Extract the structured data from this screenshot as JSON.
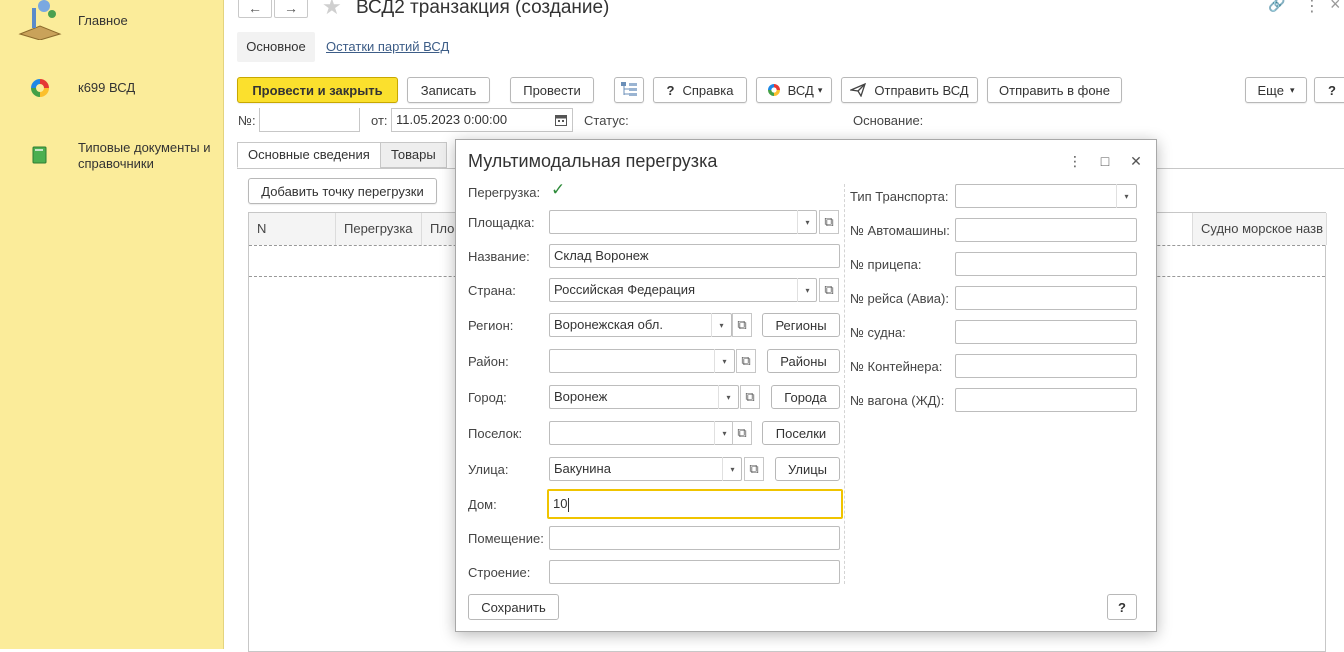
{
  "sidebar": {
    "items": [
      {
        "label": "Главное",
        "icon": "home-desk-icon"
      },
      {
        "label": "к699 ВСД",
        "icon": "vsd-logo-icon"
      },
      {
        "label": "Типовые документы и справочники",
        "icon": "book-icon"
      }
    ]
  },
  "header": {
    "title": "ВСД2 транзакция (создание)",
    "back": "←",
    "forward": "→",
    "star": "★",
    "link": "🔗",
    "more": "⋮",
    "close": "×"
  },
  "top_tabs": {
    "main": "Основное",
    "rest": "Остатки партий ВСД"
  },
  "toolbar": {
    "post_close": "Провести и закрыть",
    "save": "Записать",
    "post": "Провести",
    "help": "Справка",
    "help_icon": "?",
    "vsd": "ВСД",
    "send_vsd": "Отправить ВСД",
    "send_bg": "Отправить в фоне",
    "more": "Еще",
    "question": "?",
    "dropdown": "▾"
  },
  "doc_fields": {
    "number_label": "№:",
    "from_label": "от:",
    "date_value": "11.05.2023  0:00:00",
    "status_label": "Статус:",
    "basis_label": "Основание:"
  },
  "doc_tabs": [
    "Основные сведения",
    "Товары"
  ],
  "add_point": "Добавить точку перегрузки",
  "grid": {
    "headers": [
      "N",
      "Перегрузка",
      "Пло",
      "Судно морское назв"
    ]
  },
  "dialog": {
    "title": "Мультимодальная перегрузка",
    "controls": {
      "more": "⋮",
      "maximize": "□",
      "close": "✕"
    },
    "checkmark": "✓",
    "dd": "▾",
    "open": "⧉",
    "labels": {
      "transfer": "Перегрузка:",
      "site": "Площадка:",
      "name": "Название:",
      "country": "Страна:",
      "region": "Регион:",
      "district": "Район:",
      "city": "Город:",
      "settlement": "Поселок:",
      "street": "Улица:",
      "house": "Дом:",
      "room": "Помещение:",
      "building": "Строение:"
    },
    "values": {
      "transfer_checked": true,
      "site": "",
      "name": "Склад Воронеж",
      "country": "Российская Федерация",
      "region": "Воронежская обл.",
      "district": "",
      "city": "Воронеж",
      "settlement": "",
      "street": "Бакунина",
      "house": "10",
      "room": "",
      "building": ""
    },
    "buttons": {
      "regions": "Регионы",
      "districts": "Районы",
      "cities": "Города",
      "settlements": "Поселки",
      "streets": "Улицы",
      "save": "Сохранить",
      "help": "?"
    },
    "right_labels": {
      "transport_type": "Тип Транспорта:",
      "car_no": "№ Автомашины:",
      "trailer_no": "№ прицепа:",
      "flight_no": "№ рейса (Авиа):",
      "ship_no": "№ судна:",
      "container_no": "№ Контейнера:",
      "wagon_no": "№ вагона (ЖД):"
    }
  }
}
